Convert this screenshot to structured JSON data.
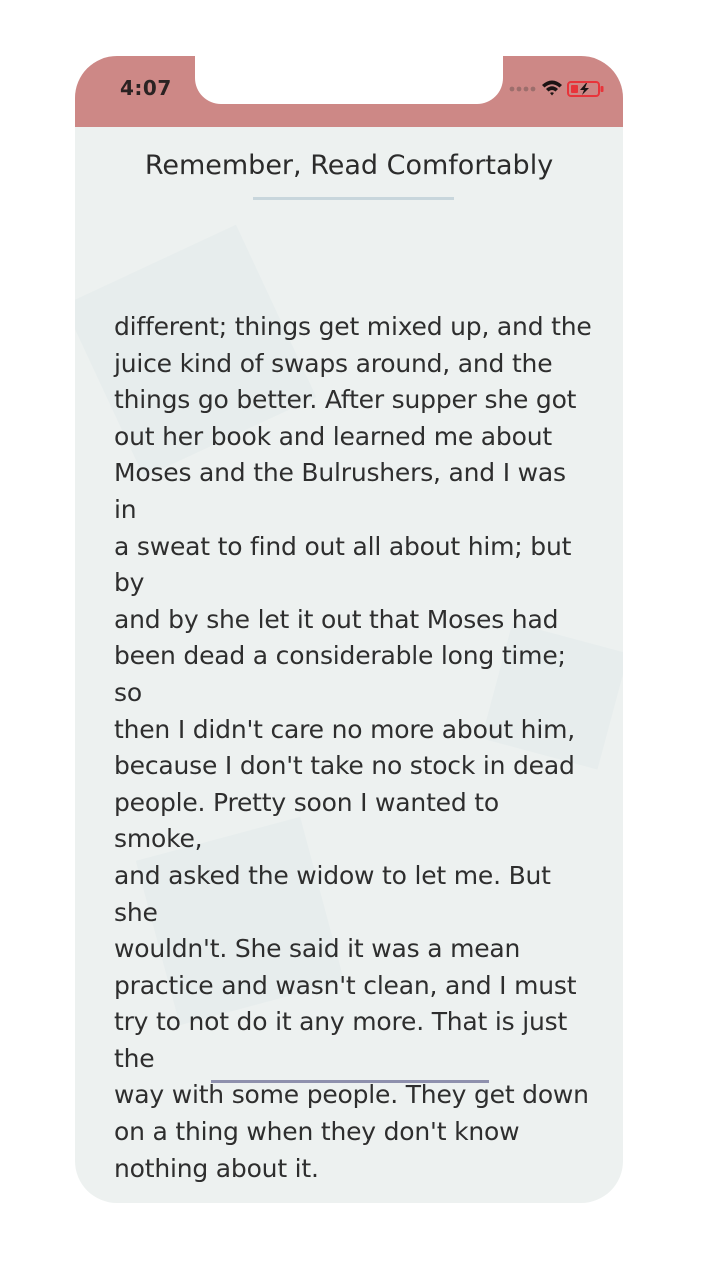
{
  "status_bar": {
    "time": "4:07",
    "icons": [
      "signal-dots-icon",
      "wifi-icon",
      "battery-charging-icon"
    ]
  },
  "header": {
    "title": "Remember, Read Comfortably"
  },
  "reader": {
    "text": "different; things get mixed up, and the\njuice kind of swaps around, and the\nthings go better. After supper she got\nout her book and learned me about\nMoses and the Bulrushers, and I was in\na sweat to find out all about him; but by\nand by she let it out that Moses had\nbeen dead a considerable long time; so\nthen I didn't care no more about him,\nbecause I don't take no stock in dead\npeople. Pretty soon I wanted to smoke,\nand asked the widow to let me. But she\nwouldn't. She said it was a mean\npractice and wasn't clean, and I must\ntry to not do it any more. That is just the\nway with some people. They get down\non a thing when they don't know\nnothing about it."
  },
  "colors": {
    "status_bar": "#cd8886",
    "page_background": "#edf1f0",
    "header_rule": "#c8d6dc",
    "footer_rule": "#8e90ad",
    "battery_accent": "#e8343a"
  }
}
